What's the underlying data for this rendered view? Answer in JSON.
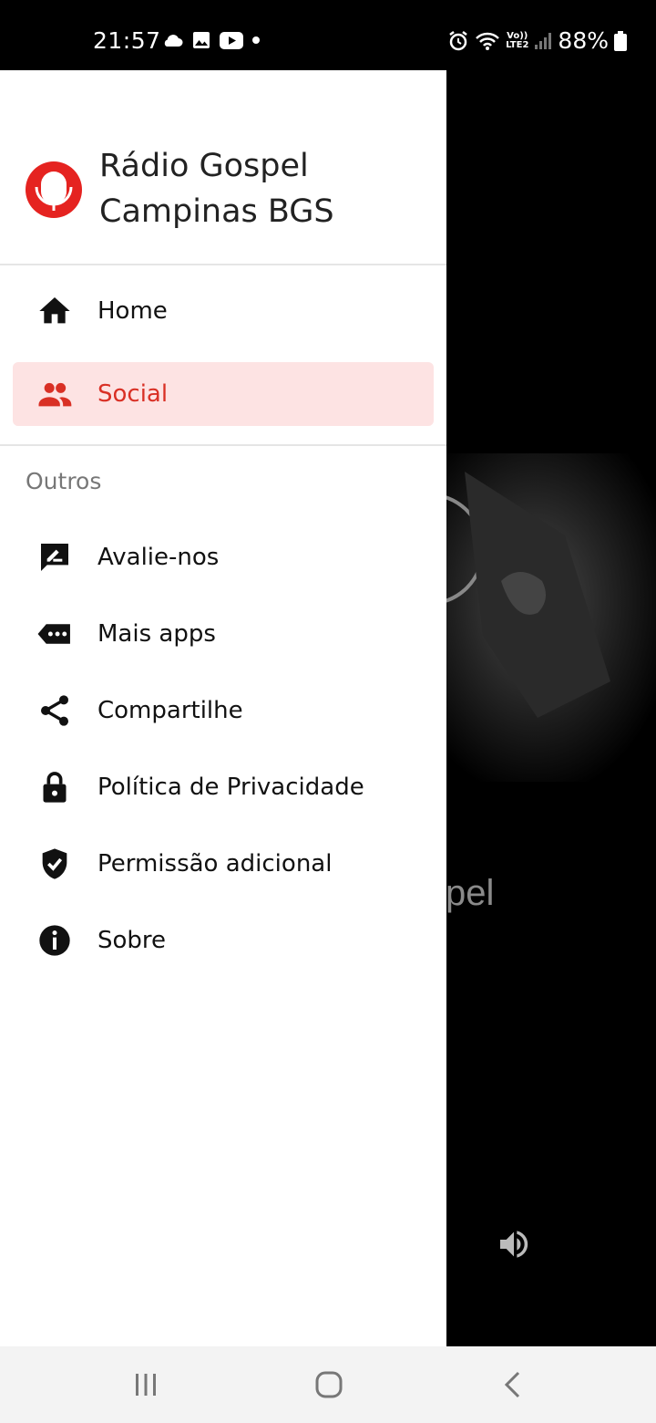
{
  "status_bar": {
    "time": "21:57",
    "left_icons": [
      "cloud-icon",
      "image-icon",
      "youtube-icon",
      "dot-icon"
    ],
    "right_icons": [
      "alarm-icon",
      "wifi-icon",
      "volte-icon",
      "signal-icon",
      "battery-icon"
    ],
    "volte_line1": "Vo))",
    "volte_line2": "LTE2",
    "battery": "88%"
  },
  "drawer": {
    "app_name_line1": "Rádio Gospel",
    "app_name_line2": "Campinas BGS",
    "primary_items": [
      {
        "label": "Home",
        "icon": "home-icon",
        "active": false
      },
      {
        "label": "Social",
        "icon": "group-icon",
        "active": true
      }
    ],
    "section_label": "Outros",
    "secondary_items": [
      {
        "label": "Avalie-nos",
        "icon": "rate-review-icon"
      },
      {
        "label": "Mais apps",
        "icon": "more-apps-icon"
      },
      {
        "label": "Compartilhe",
        "icon": "share-icon"
      },
      {
        "label": "Política de Privacidade",
        "icon": "lock-icon"
      },
      {
        "label": "Permissão adicional",
        "icon": "shield-check-icon"
      },
      {
        "label": "Sobre",
        "icon": "info-icon"
      }
    ]
  },
  "background": {
    "title_partial": "Rádio Gospel Campinas"
  },
  "navigation_bar": {
    "buttons": [
      "recents-icon",
      "home-circle-icon",
      "back-icon"
    ]
  },
  "colors": {
    "accent": "#d93025",
    "active_bg": "#fde3e3",
    "drawer_bg": "#ffffff",
    "backdrop": "#000000",
    "nav_bar": "#f3f3f3"
  }
}
